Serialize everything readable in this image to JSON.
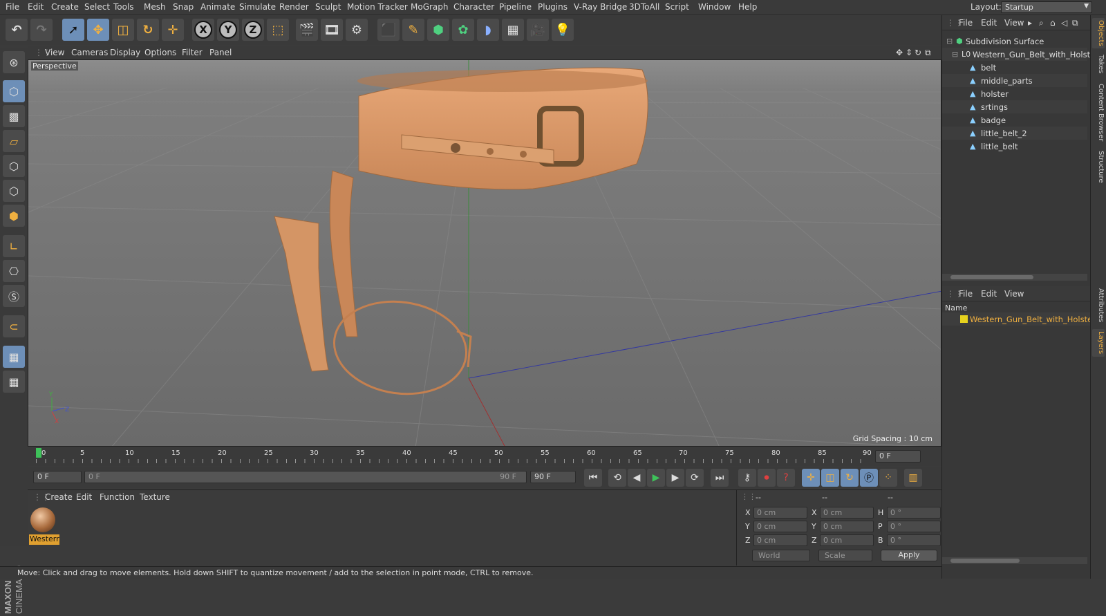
{
  "menubar": {
    "items": [
      "File",
      "Edit",
      "Create",
      "Select",
      "Tools",
      "Mesh",
      "Snap",
      "Animate",
      "Simulate",
      "Render",
      "Sculpt",
      "Motion Tracker",
      "MoGraph",
      "Character",
      "Pipeline",
      "Plugins",
      "V-Ray Bridge",
      "3DToAll",
      "Script",
      "Window",
      "Help"
    ],
    "layout_label": "Layout:",
    "layout_value": "Startup"
  },
  "toolbar": {
    "undo": "undo-icon",
    "redo": "redo-icon",
    "axis_x": "X",
    "axis_y": "Y",
    "axis_z": "Z"
  },
  "viewport": {
    "menu": [
      "View",
      "Cameras",
      "Display",
      "Options",
      "Filter",
      "Panel"
    ],
    "label": "Perspective",
    "grid_spacing": "Grid Spacing : 10 cm",
    "axis_y": "Y",
    "axis_z": "Z",
    "axis_x": "X"
  },
  "timeline": {
    "ticks": [
      "0",
      "5",
      "10",
      "15",
      "20",
      "25",
      "30",
      "35",
      "40",
      "45",
      "50",
      "55",
      "60",
      "65",
      "70",
      "75",
      "80",
      "85",
      "90"
    ],
    "current_frame": "0 F",
    "start_frame": "0 F",
    "range_start": "0 F",
    "range_end": "90 F",
    "end_frame": "90 F"
  },
  "materials": {
    "menu": [
      "Create",
      "Edit",
      "Function",
      "Texture"
    ],
    "items": [
      {
        "name": "Westerr"
      }
    ]
  },
  "coords": {
    "headers": [
      "--",
      "--",
      "--"
    ],
    "rows": [
      {
        "a": "X",
        "av": "0 cm",
        "b": "X",
        "bv": "0 cm",
        "c": "H",
        "cv": "0 °"
      },
      {
        "a": "Y",
        "av": "0 cm",
        "b": "Y",
        "bv": "0 cm",
        "c": "P",
        "cv": "0 °"
      },
      {
        "a": "Z",
        "av": "0 cm",
        "b": "Z",
        "bv": "0 cm",
        "c": "B",
        "cv": "0 °"
      }
    ],
    "mode_world": "World",
    "mode_scale": "Scale",
    "apply": "Apply"
  },
  "status": "Move: Click and drag to move elements. Hold down SHIFT to quantize movement / add to the selection in point mode, CTRL to remove.",
  "branding": {
    "line1": "MAXON",
    "line2": "CINEMA 4D"
  },
  "objects": {
    "menu": [
      "File",
      "Edit",
      "View"
    ],
    "tree": [
      {
        "name": "Subdivision Surface",
        "depth": 0
      },
      {
        "name": "Western_Gun_Belt_with_Holster",
        "depth": 1
      },
      {
        "name": "belt",
        "depth": 2
      },
      {
        "name": "middle_parts",
        "depth": 2
      },
      {
        "name": "holster",
        "depth": 2
      },
      {
        "name": "srtings",
        "depth": 2
      },
      {
        "name": "badge",
        "depth": 2
      },
      {
        "name": "little_belt_2",
        "depth": 2
      },
      {
        "name": "little_belt",
        "depth": 2
      }
    ]
  },
  "layers": {
    "menu": [
      "File",
      "Edit",
      "View"
    ],
    "column": "Name",
    "rows": [
      {
        "name": "Western_Gun_Belt_with_Holster",
        "color": "#e6d21e"
      }
    ]
  },
  "side_tabs": [
    "Objects",
    "Takes",
    "Content Browser",
    "Structure",
    "Attributes",
    "Layers"
  ],
  "colors": {
    "accent": "#6d8fb8",
    "selected_text": "#f0b040"
  }
}
